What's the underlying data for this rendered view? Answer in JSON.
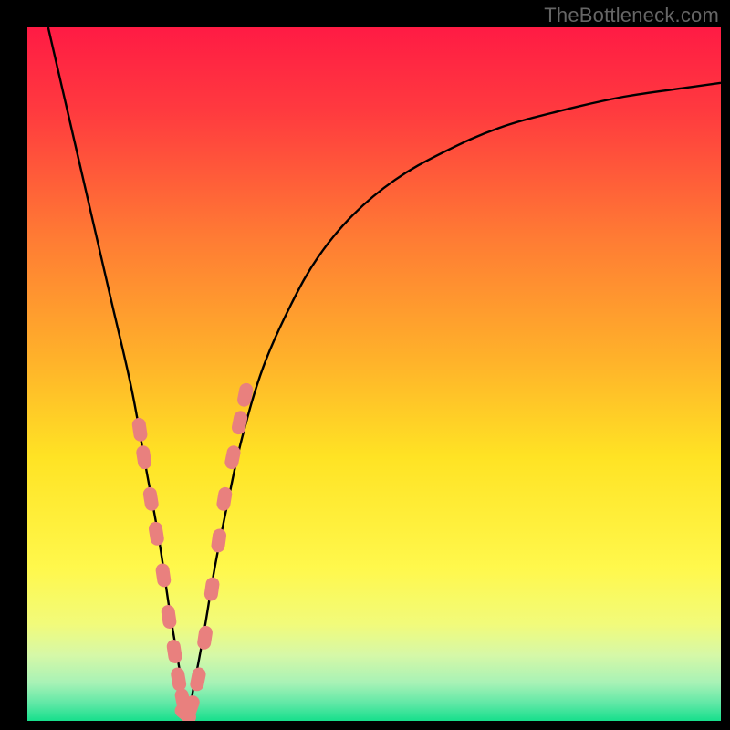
{
  "watermark": "TheBottleneck.com",
  "colors": {
    "frame": "#000000",
    "curve_stroke": "#000000",
    "marker_fill": "#e9807e",
    "gradient_stops": [
      {
        "offset": 0.0,
        "color": "#ff1b44"
      },
      {
        "offset": 0.12,
        "color": "#ff3a3f"
      },
      {
        "offset": 0.3,
        "color": "#ff7a34"
      },
      {
        "offset": 0.48,
        "color": "#ffb22a"
      },
      {
        "offset": 0.62,
        "color": "#ffe324"
      },
      {
        "offset": 0.78,
        "color": "#fff84c"
      },
      {
        "offset": 0.86,
        "color": "#f2fb7a"
      },
      {
        "offset": 0.905,
        "color": "#d6f8a7"
      },
      {
        "offset": 0.945,
        "color": "#a8f2b6"
      },
      {
        "offset": 0.975,
        "color": "#5fe8a6"
      },
      {
        "offset": 1.0,
        "color": "#17df8c"
      }
    ]
  },
  "chart_data": {
    "type": "line",
    "title": "",
    "xlabel": "",
    "ylabel": "",
    "x_range": [
      0,
      100
    ],
    "y_range": [
      0,
      100
    ],
    "minimum_x": 23,
    "series": [
      {
        "name": "bottleneck-curve",
        "x": [
          3,
          6,
          9,
          12,
          15,
          17,
          19,
          20.5,
          22,
          23,
          24,
          25.5,
          27,
          29,
          31,
          34,
          38,
          42,
          47,
          53,
          60,
          68,
          77,
          86,
          95,
          100
        ],
        "y": [
          100,
          87,
          74,
          61,
          48,
          37,
          26,
          16,
          7,
          0.5,
          5,
          13,
          22,
          32,
          41,
          51,
          60,
          67,
          73,
          78,
          82,
          85.5,
          88,
          90,
          91.3,
          92
        ]
      }
    ],
    "markers": {
      "name": "highlighted-points",
      "shape": "rounded-capsule",
      "x": [
        16.2,
        16.8,
        17.8,
        18.6,
        19.6,
        20.4,
        21.2,
        21.8,
        22.4,
        22.8,
        23.6,
        24.6,
        25.6,
        26.6,
        27.6,
        28.4,
        29.6,
        30.6,
        31.4
      ],
      "y": [
        42,
        38,
        32,
        27,
        21,
        15,
        10,
        6,
        3,
        1,
        2,
        6,
        12,
        19,
        26,
        32,
        38,
        43,
        47
      ]
    }
  }
}
